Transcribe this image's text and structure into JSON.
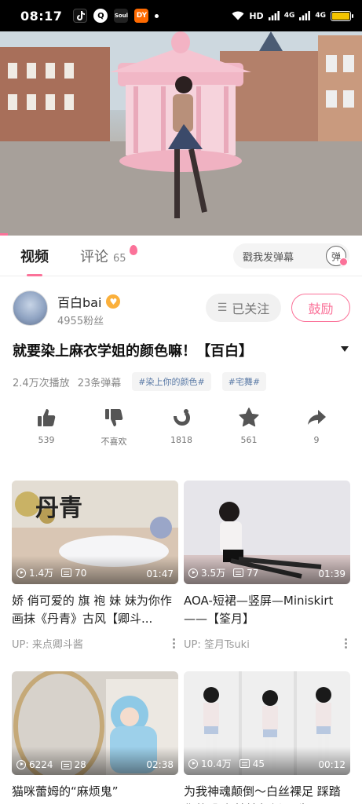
{
  "status_bar": {
    "time": "08:17",
    "apps": [
      "TikTok",
      "Q",
      "Soul",
      "DouYu"
    ],
    "network": "HD",
    "signal1": "4G",
    "signal2": "4G"
  },
  "tabs": {
    "video": "视频",
    "comments": "评论",
    "comment_count": "65"
  },
  "danmaku": {
    "placeholder": "戳我发弹幕",
    "toggle_label": "弹"
  },
  "uploader": {
    "name": "百白bai",
    "fans": "4955粉丝",
    "follow_label": "已关注",
    "cheer_label": "鼓励"
  },
  "video": {
    "title": "就要染上麻衣学姐的颜色嘛！【百白】",
    "plays": "2.4万次播放",
    "danmaku_count": "23条弹幕",
    "tags": [
      "#染上你的颜色#",
      "#宅舞#"
    ]
  },
  "actions": [
    {
      "icon": "like-icon",
      "label": "539"
    },
    {
      "icon": "dislike-icon",
      "label": "不喜欢"
    },
    {
      "icon": "coin-icon",
      "label": "1818"
    },
    {
      "icon": "favorite-icon",
      "label": "561"
    },
    {
      "icon": "share-icon",
      "label": "9"
    }
  ],
  "recommendations": [
    {
      "plays": "1.4万",
      "danmaku": "70",
      "duration": "01:47",
      "title": "娇 俏可爱的 旗 袍 妹 妹为你作画抹《丹青》古风【卿斗...",
      "up": "UP: 来点卿斗酱",
      "thumb_text": "丹青"
    },
    {
      "plays": "3.5万",
      "danmaku": "77",
      "duration": "01:39",
      "title": "AOA-短裙—竖屏—Miniskirt——【筌月】",
      "up": "UP: 筌月Tsuki"
    },
    {
      "plays": "6224",
      "danmaku": "28",
      "duration": "02:38",
      "title": "猫咪蕾姆的“麻烦鬼”",
      "up": ""
    },
    {
      "plays": "10.4万",
      "danmaku": "45",
      "duration": "00:12",
      "title": "为我神魂颠倒～白丝裸足 踩踏你的肌肤 抽搐颠倒 双先",
      "up": ""
    }
  ],
  "colors": {
    "accent": "#fb7299",
    "tag_text": "#5a7aa6"
  }
}
